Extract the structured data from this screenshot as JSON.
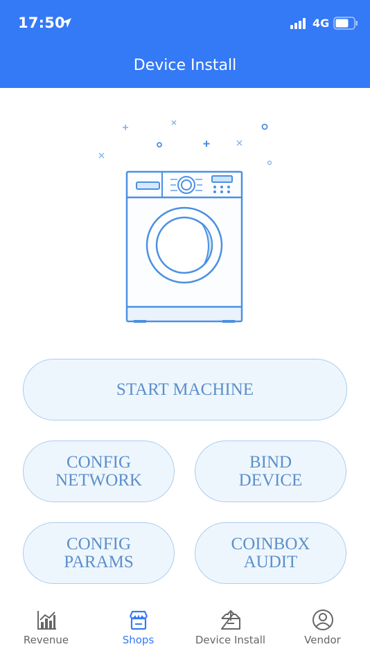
{
  "status_bar": {
    "time": "17:50",
    "network": "4G"
  },
  "header": {
    "title": "Device Install"
  },
  "illustration": {
    "icon": "washing-machine-icon",
    "accent": "#4a90e2"
  },
  "actions": {
    "start_machine": "START MACHINE",
    "config_network": "CONFIG\nNETWORK",
    "bind_device": "BIND\nDEVICE",
    "config_params": "CONFIG\nPARAMS",
    "coinbox_audit": "COINBOX\nAUDIT"
  },
  "tabbar": {
    "active": "Shops",
    "items": [
      {
        "label": "Revenue",
        "icon": "revenue-chart-icon"
      },
      {
        "label": "Shops",
        "icon": "shop-icon"
      },
      {
        "label": "Device Install",
        "icon": "device-install-icon"
      },
      {
        "label": "Vendor",
        "icon": "user-icon"
      }
    ]
  },
  "colors": {
    "primary": "#3479f6",
    "button_bg": "#eef6fd",
    "button_border": "#a9cdee",
    "button_text": "#5b8fca",
    "tab_inactive": "#666666"
  }
}
